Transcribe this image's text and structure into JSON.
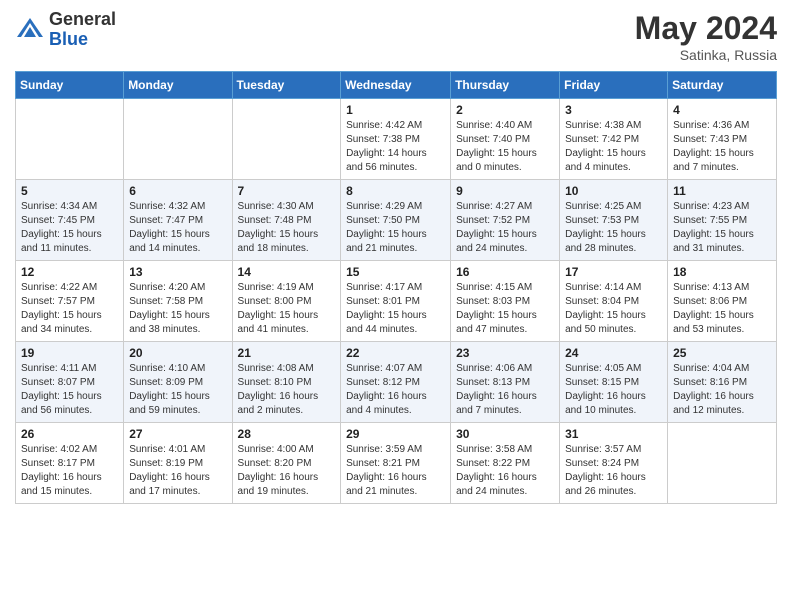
{
  "header": {
    "logo_general": "General",
    "logo_blue": "Blue",
    "month_year": "May 2024",
    "location": "Satinka, Russia"
  },
  "weekdays": [
    "Sunday",
    "Monday",
    "Tuesday",
    "Wednesday",
    "Thursday",
    "Friday",
    "Saturday"
  ],
  "weeks": [
    [
      {
        "day": "",
        "info": ""
      },
      {
        "day": "",
        "info": ""
      },
      {
        "day": "",
        "info": ""
      },
      {
        "day": "1",
        "info": "Sunrise: 4:42 AM\nSunset: 7:38 PM\nDaylight: 14 hours\nand 56 minutes."
      },
      {
        "day": "2",
        "info": "Sunrise: 4:40 AM\nSunset: 7:40 PM\nDaylight: 15 hours\nand 0 minutes."
      },
      {
        "day": "3",
        "info": "Sunrise: 4:38 AM\nSunset: 7:42 PM\nDaylight: 15 hours\nand 4 minutes."
      },
      {
        "day": "4",
        "info": "Sunrise: 4:36 AM\nSunset: 7:43 PM\nDaylight: 15 hours\nand 7 minutes."
      }
    ],
    [
      {
        "day": "5",
        "info": "Sunrise: 4:34 AM\nSunset: 7:45 PM\nDaylight: 15 hours\nand 11 minutes."
      },
      {
        "day": "6",
        "info": "Sunrise: 4:32 AM\nSunset: 7:47 PM\nDaylight: 15 hours\nand 14 minutes."
      },
      {
        "day": "7",
        "info": "Sunrise: 4:30 AM\nSunset: 7:48 PM\nDaylight: 15 hours\nand 18 minutes."
      },
      {
        "day": "8",
        "info": "Sunrise: 4:29 AM\nSunset: 7:50 PM\nDaylight: 15 hours\nand 21 minutes."
      },
      {
        "day": "9",
        "info": "Sunrise: 4:27 AM\nSunset: 7:52 PM\nDaylight: 15 hours\nand 24 minutes."
      },
      {
        "day": "10",
        "info": "Sunrise: 4:25 AM\nSunset: 7:53 PM\nDaylight: 15 hours\nand 28 minutes."
      },
      {
        "day": "11",
        "info": "Sunrise: 4:23 AM\nSunset: 7:55 PM\nDaylight: 15 hours\nand 31 minutes."
      }
    ],
    [
      {
        "day": "12",
        "info": "Sunrise: 4:22 AM\nSunset: 7:57 PM\nDaylight: 15 hours\nand 34 minutes."
      },
      {
        "day": "13",
        "info": "Sunrise: 4:20 AM\nSunset: 7:58 PM\nDaylight: 15 hours\nand 38 minutes."
      },
      {
        "day": "14",
        "info": "Sunrise: 4:19 AM\nSunset: 8:00 PM\nDaylight: 15 hours\nand 41 minutes."
      },
      {
        "day": "15",
        "info": "Sunrise: 4:17 AM\nSunset: 8:01 PM\nDaylight: 15 hours\nand 44 minutes."
      },
      {
        "day": "16",
        "info": "Sunrise: 4:15 AM\nSunset: 8:03 PM\nDaylight: 15 hours\nand 47 minutes."
      },
      {
        "day": "17",
        "info": "Sunrise: 4:14 AM\nSunset: 8:04 PM\nDaylight: 15 hours\nand 50 minutes."
      },
      {
        "day": "18",
        "info": "Sunrise: 4:13 AM\nSunset: 8:06 PM\nDaylight: 15 hours\nand 53 minutes."
      }
    ],
    [
      {
        "day": "19",
        "info": "Sunrise: 4:11 AM\nSunset: 8:07 PM\nDaylight: 15 hours\nand 56 minutes."
      },
      {
        "day": "20",
        "info": "Sunrise: 4:10 AM\nSunset: 8:09 PM\nDaylight: 15 hours\nand 59 minutes."
      },
      {
        "day": "21",
        "info": "Sunrise: 4:08 AM\nSunset: 8:10 PM\nDaylight: 16 hours\nand 2 minutes."
      },
      {
        "day": "22",
        "info": "Sunrise: 4:07 AM\nSunset: 8:12 PM\nDaylight: 16 hours\nand 4 minutes."
      },
      {
        "day": "23",
        "info": "Sunrise: 4:06 AM\nSunset: 8:13 PM\nDaylight: 16 hours\nand 7 minutes."
      },
      {
        "day": "24",
        "info": "Sunrise: 4:05 AM\nSunset: 8:15 PM\nDaylight: 16 hours\nand 10 minutes."
      },
      {
        "day": "25",
        "info": "Sunrise: 4:04 AM\nSunset: 8:16 PM\nDaylight: 16 hours\nand 12 minutes."
      }
    ],
    [
      {
        "day": "26",
        "info": "Sunrise: 4:02 AM\nSunset: 8:17 PM\nDaylight: 16 hours\nand 15 minutes."
      },
      {
        "day": "27",
        "info": "Sunrise: 4:01 AM\nSunset: 8:19 PM\nDaylight: 16 hours\nand 17 minutes."
      },
      {
        "day": "28",
        "info": "Sunrise: 4:00 AM\nSunset: 8:20 PM\nDaylight: 16 hours\nand 19 minutes."
      },
      {
        "day": "29",
        "info": "Sunrise: 3:59 AM\nSunset: 8:21 PM\nDaylight: 16 hours\nand 21 minutes."
      },
      {
        "day": "30",
        "info": "Sunrise: 3:58 AM\nSunset: 8:22 PM\nDaylight: 16 hours\nand 24 minutes."
      },
      {
        "day": "31",
        "info": "Sunrise: 3:57 AM\nSunset: 8:24 PM\nDaylight: 16 hours\nand 26 minutes."
      },
      {
        "day": "",
        "info": ""
      }
    ]
  ]
}
